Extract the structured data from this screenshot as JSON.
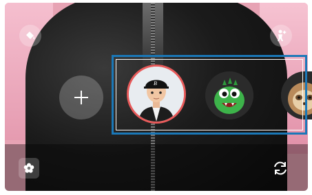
{
  "toolbar": {
    "background_effect_icon": "paint-bucket-icon",
    "avatar_mode_icon": "person-sparkle-icon",
    "add_icon": "plus-icon",
    "filter_icon": "flower-icon",
    "switch_camera_icon": "camera-flip-icon"
  },
  "stickers": [
    {
      "name": "my-emoji",
      "selected": true
    },
    {
      "name": "green-dinosaur",
      "selected": false
    },
    {
      "name": "sloth",
      "selected": false
    }
  ],
  "modes": [
    {
      "label": "",
      "active": false
    },
    {
      "label": "",
      "active": false
    }
  ],
  "colors": {
    "selection_ring": "#e85a5a",
    "highlight_box": "#1a78b8",
    "background_pink": "#e7a3b4"
  }
}
